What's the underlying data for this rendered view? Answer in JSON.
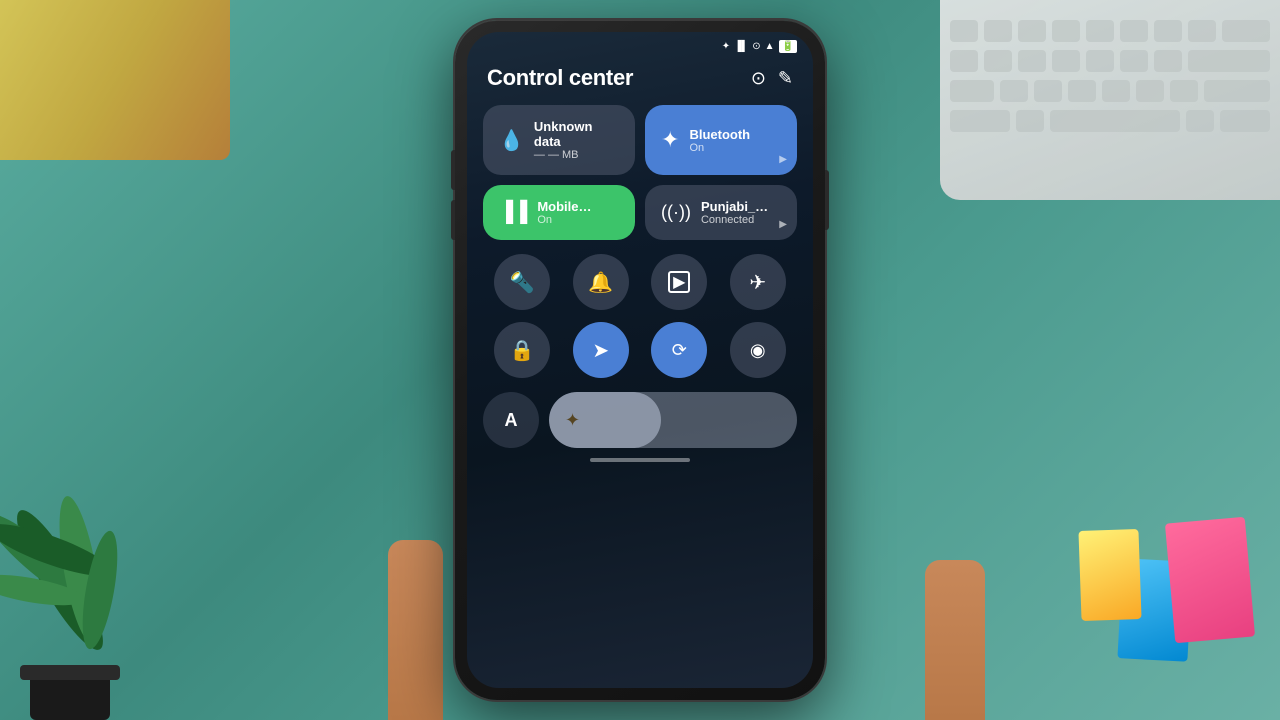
{
  "background": {
    "color": "#4a9a8e"
  },
  "statusBar": {
    "icons": [
      "♦",
      "▐▐",
      "⊙",
      "▲",
      "🔋"
    ]
  },
  "header": {
    "title": "Control center",
    "settingsIcon": "⊙",
    "editIcon": "✎"
  },
  "tiles": [
    {
      "id": "data",
      "label": "Unknown data",
      "sublabel": "— — MB",
      "icon": "💧",
      "style": "default"
    },
    {
      "id": "bluetooth",
      "label": "Bluetooth",
      "sublabel": "On",
      "icon": "✦",
      "style": "blue"
    },
    {
      "id": "mobile",
      "label": "Mobile…",
      "sublabel": "On",
      "icon": "▐▐",
      "style": "green"
    },
    {
      "id": "wifi",
      "label": "Punjabi_…",
      "sublabel": "Connected",
      "icon": "((•))",
      "style": "default"
    }
  ],
  "iconRow1": [
    {
      "id": "flashlight",
      "icon": "🔦",
      "style": "default",
      "label": "Flashlight"
    },
    {
      "id": "notification",
      "icon": "🔔",
      "style": "default",
      "label": "Notification"
    },
    {
      "id": "screen-record",
      "icon": "⬛",
      "style": "default",
      "label": "Screen record"
    },
    {
      "id": "airplane",
      "icon": "✈",
      "style": "default",
      "label": "Airplane mode"
    }
  ],
  "iconRow2": [
    {
      "id": "lock",
      "icon": "🔒",
      "style": "default",
      "label": "Lock"
    },
    {
      "id": "location",
      "icon": "➤",
      "style": "blue",
      "label": "Location"
    },
    {
      "id": "auto-rotate",
      "icon": "⟳",
      "style": "blue",
      "label": "Auto rotate"
    },
    {
      "id": "eye",
      "icon": "◎",
      "style": "default",
      "label": "Reading mode"
    }
  ],
  "bottomRow": {
    "fontButton": "A",
    "brightnessIcon": "✦",
    "brightnessValue": 45
  },
  "homeIndicator": true
}
